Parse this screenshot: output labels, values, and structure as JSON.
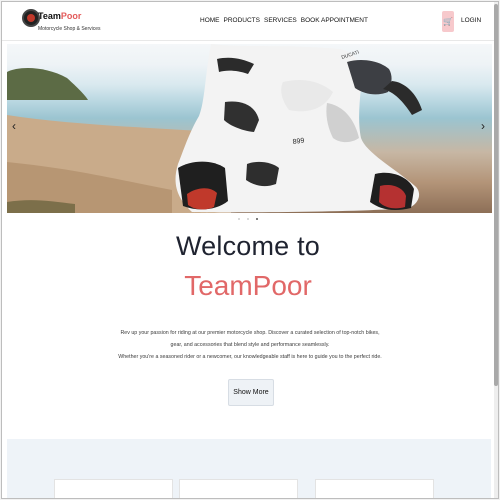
{
  "header": {
    "brand_main": "Team",
    "brand_accent": "Poor",
    "tagline": "Motorcycle Shop & Services",
    "nav": [
      {
        "label": "HOME"
      },
      {
        "label": "PRODUCTS"
      },
      {
        "label": "SERVICES"
      },
      {
        "label": "BOOK APPOINTMENT"
      }
    ],
    "login_label": "LOGIN",
    "cart_icon": "cart-icon"
  },
  "hero": {
    "prev_icon": "chevron-left-icon",
    "next_icon": "chevron-right-icon",
    "slides_count": 3,
    "active_slide": 3,
    "bike_label": "DUCATI",
    "bike_model": "899",
    "bike_plate": "899 Panigale"
  },
  "welcome": {
    "line1": "Welcome to",
    "line2": "TeamPoor",
    "paragraph_1": "Rev up your passion for riding at our premier motorcycle shop. Discover a curated selection of top-notch bikes,",
    "paragraph_2": "gear, and accessories that blend style and performance seamlessly.",
    "paragraph_3": "Whether you're a seasoned rider or a newcomer, our knowledgeable staff is here to guide you to the perfect ride.",
    "show_more_label": "Show More"
  },
  "colors": {
    "accent": "#e16868",
    "dark_text": "#1f2330",
    "section_bg": "#eef3f8"
  }
}
